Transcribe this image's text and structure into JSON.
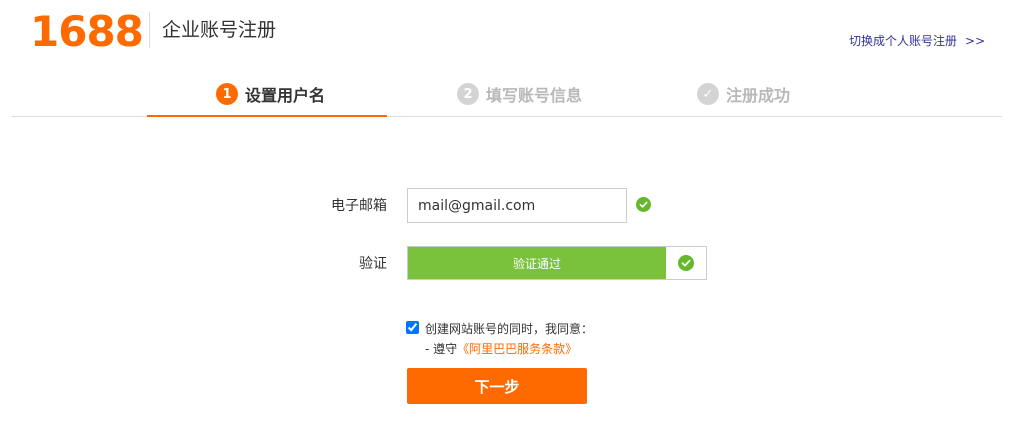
{
  "header": {
    "logo_text": "1688",
    "title": "企业账号注册",
    "switch_link": "切换成个人账号注册",
    "switch_arrow": ">>"
  },
  "steps": [
    {
      "number": "1",
      "label": "设置用户名",
      "state": "active"
    },
    {
      "number": "2",
      "label": "填写账号信息",
      "state": "todo"
    },
    {
      "number": "✓",
      "label": "注册成功",
      "state": "todo"
    }
  ],
  "form": {
    "email_label": "电子邮箱",
    "email_value": "mail@gmail.com",
    "verify_label": "验证",
    "verify_text": "验证通过"
  },
  "agreement": {
    "checked": true,
    "line1": "创建网站账号的同时，我同意：",
    "line2_prefix": "- 遵守",
    "terms_link": "《阿里巴巴服务条款》"
  },
  "next_button": "下一步",
  "colors": {
    "brand_orange": "#ff6a00",
    "success_green": "#7ac23c",
    "check_green": "#66b82a",
    "inactive_gray": "#d4d4d4"
  }
}
